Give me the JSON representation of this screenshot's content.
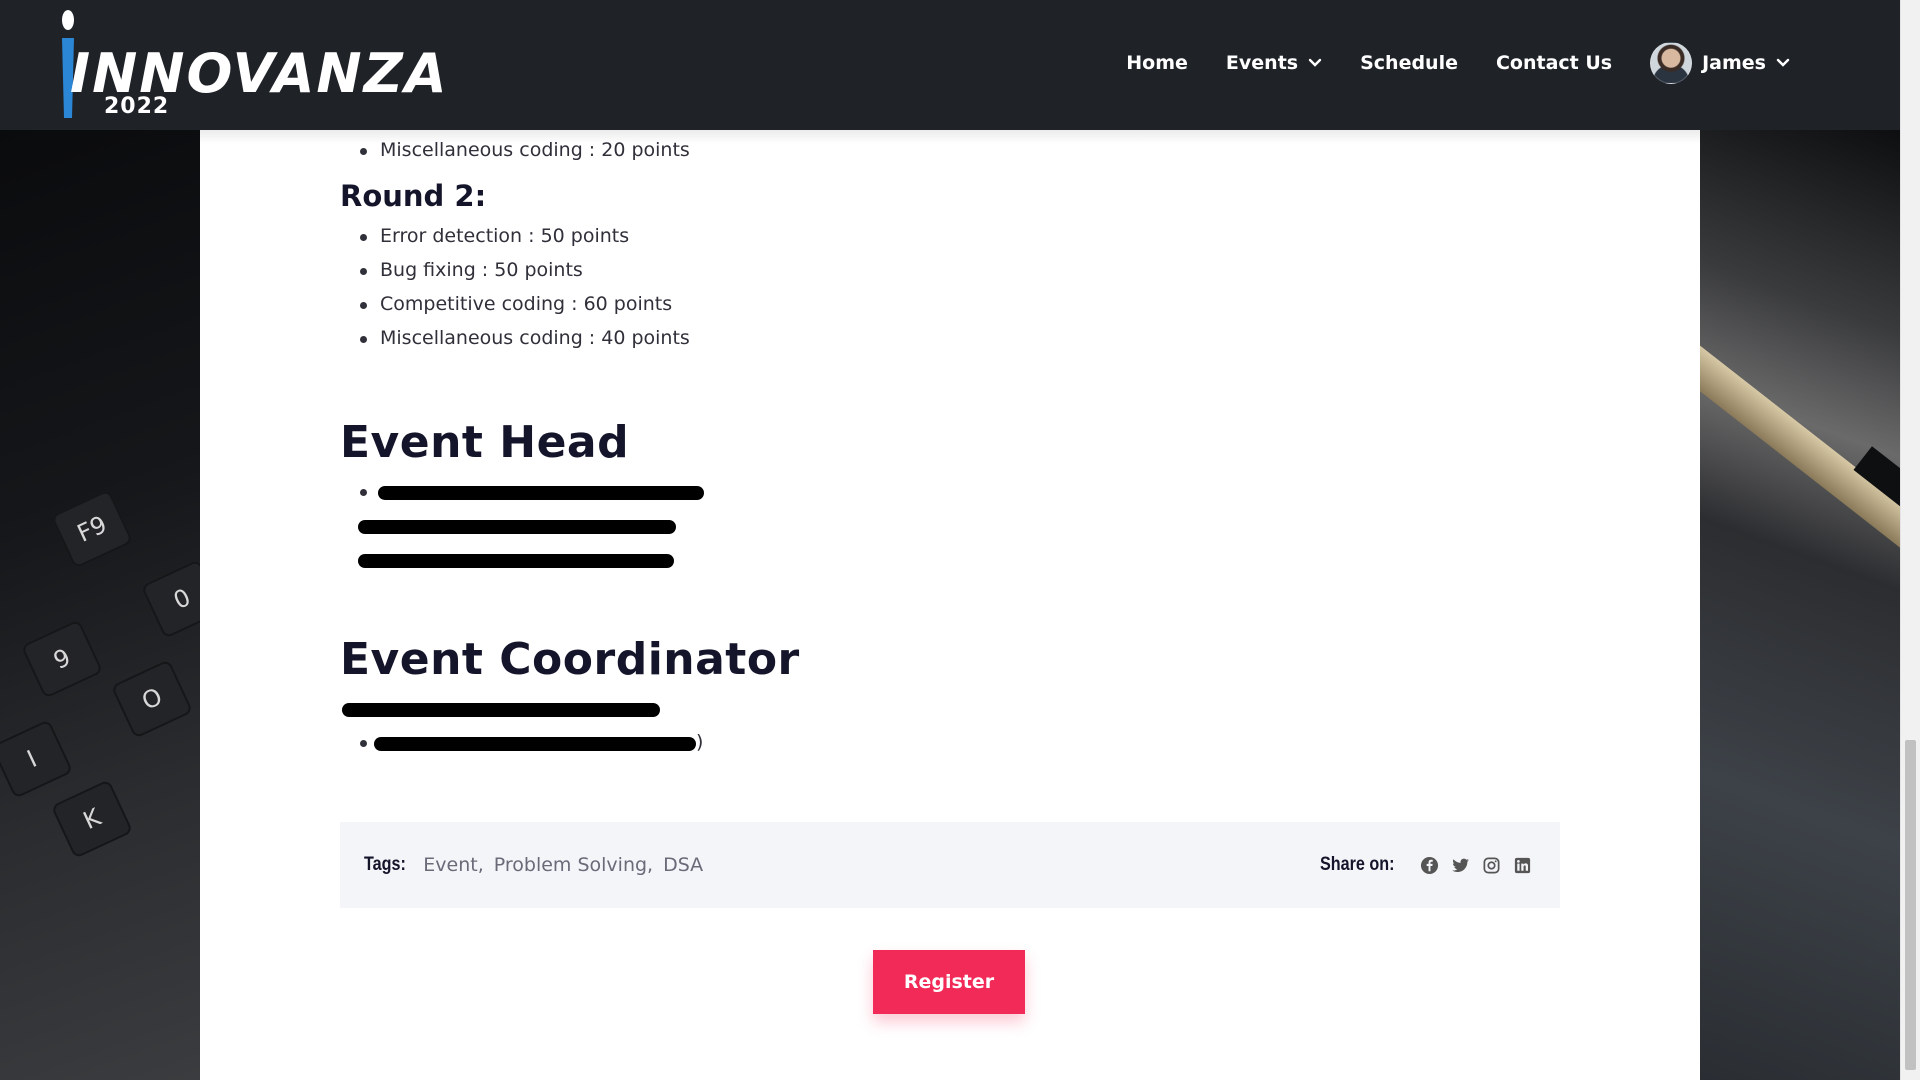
{
  "header": {
    "logo_text": "INNOVANZA",
    "logo_year": "2022",
    "nav": [
      {
        "label": "Home",
        "icon": null
      },
      {
        "label": "Events",
        "icon": "chevron-down-icon"
      },
      {
        "label": "Schedule",
        "icon": null
      },
      {
        "label": "Contact Us",
        "icon": null
      }
    ],
    "user": {
      "name": "James",
      "icon": "chevron-down-icon"
    }
  },
  "round1_tail": [
    "Miscellaneous coding : 20 points"
  ],
  "round2": {
    "title": "Round 2:",
    "items": [
      "Error detection : 50 points",
      "Bug fixing : 50 points",
      "Competitive coding : 60 points",
      "Miscellaneous coding : 40 points"
    ]
  },
  "event_head": {
    "title": "Event Head",
    "people": [
      "(redacted)",
      "(redacted)",
      "(redacted)"
    ]
  },
  "event_coordinator": {
    "title": "Event Coordinator",
    "people": [
      "(redacted)",
      "(redacted)"
    ],
    "visible_suffix": ")"
  },
  "tags": {
    "label": "Tags:",
    "items": [
      "Event,",
      "Problem Solving,",
      "DSA"
    ]
  },
  "share": {
    "label": "Share on:",
    "icons": [
      "facebook-icon",
      "twitter-icon",
      "instagram-icon",
      "linkedin-icon"
    ]
  },
  "register_label": "Register",
  "colors": {
    "header_bg": "#1f2328",
    "accent": "#f22a58",
    "logo_blue": "#2b86d6",
    "heading": "#14142a"
  }
}
